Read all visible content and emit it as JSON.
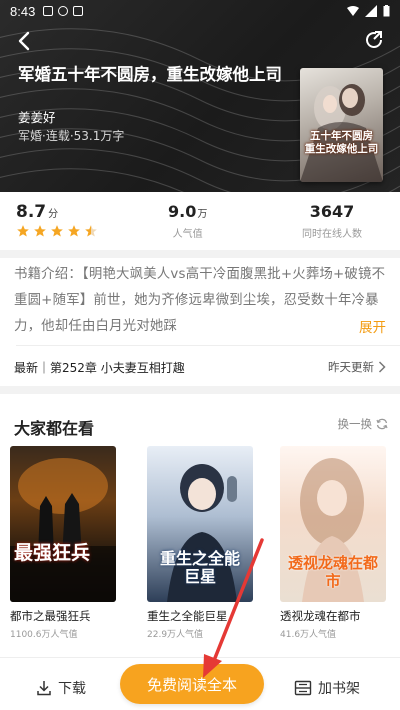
{
  "statusbar": {
    "time": "8:43"
  },
  "book": {
    "title": "军婚五十年不圆房，重生改嫁他上司",
    "author": "姜姜好",
    "meta": "军婚·连载·53.1万字",
    "cover_text": "五十年不圆房\n重生改嫁他上司"
  },
  "stats": {
    "score": {
      "value": "8.7",
      "unit": "分",
      "stars": 4.5
    },
    "popularity": {
      "value": "9.0",
      "unit": "万",
      "label": "人气值"
    },
    "online": {
      "value": "3647",
      "label": "同时在线人数"
    }
  },
  "intro": {
    "label": "书籍介绍：",
    "text": "【明艳大飒美人vs高干冷面腹黑批+火葬场+破镜不重圆+随军】前世，她为齐修远卑微到尘埃，忍受数十年冷暴力，他却任由白月光对她踩",
    "expand_label": "展开"
  },
  "latest": {
    "text": "最新｜第252章 小夫妻互相打趣",
    "update": "昨天更新"
  },
  "recommend": {
    "title": "大家都在看",
    "refresh_label": "换一换",
    "books": [
      {
        "name": "都市之最强狂兵",
        "popularity": "1100.6万人气值",
        "cover_text": "最强狂兵"
      },
      {
        "name": "重生之全能巨星",
        "popularity": "22.9万人气值",
        "cover_text": "重生之全能巨星"
      },
      {
        "name": "透视龙魂在都市",
        "popularity": "41.6万人气值",
        "cover_text": "透视龙魂在都市"
      }
    ]
  },
  "bottom": {
    "download_label": "下载",
    "read_label": "免费阅读全本",
    "shelf_label": "加书架"
  },
  "colors": {
    "accent": "#f7a31f",
    "star": "#f5a623",
    "header_bg": "#1f1f1f",
    "arrow": "#e53935"
  }
}
